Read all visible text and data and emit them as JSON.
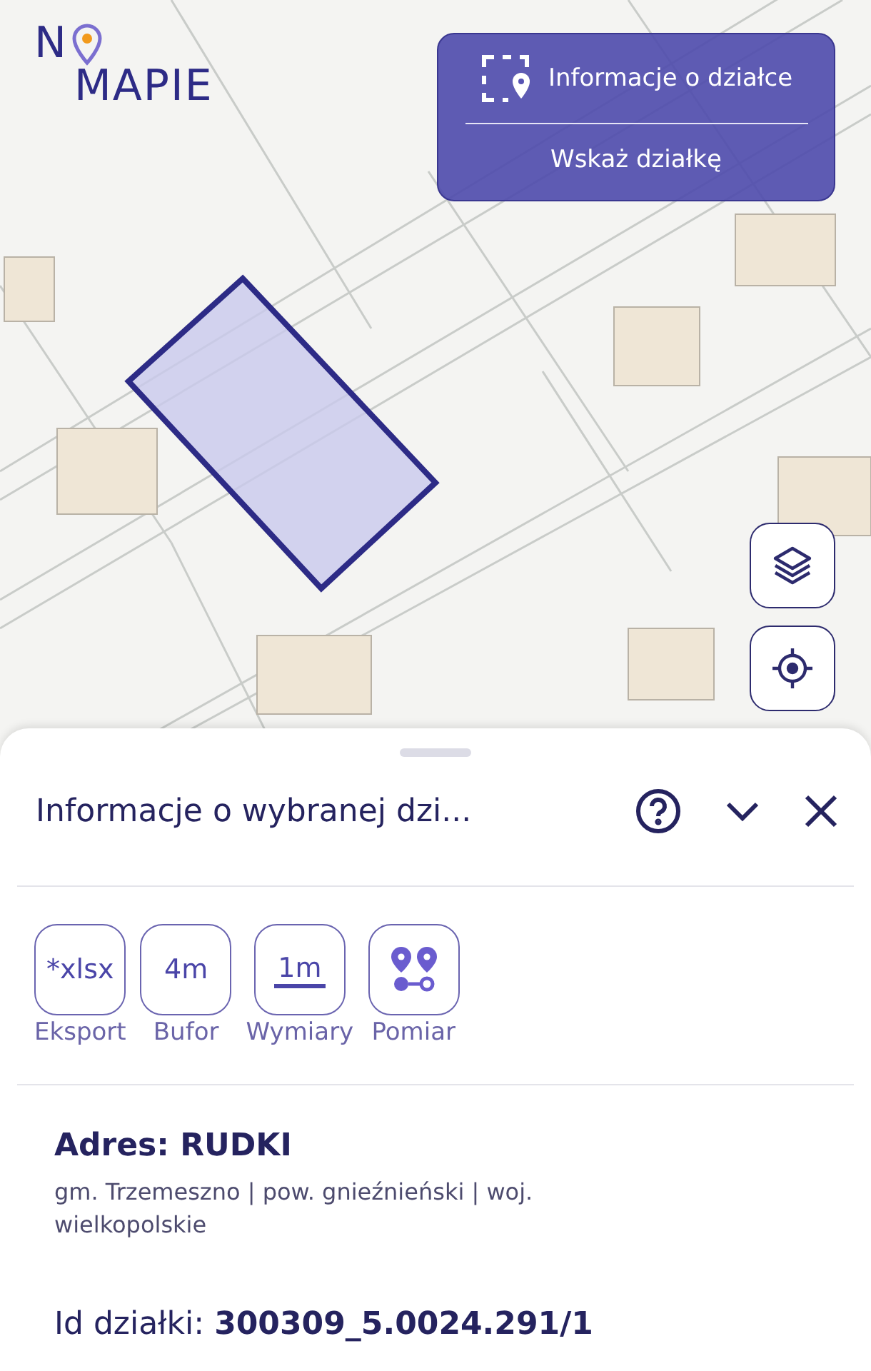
{
  "logo": {
    "first": "N",
    "second": "MAPIE"
  },
  "parcel_menu": {
    "items": [
      {
        "kind": "icon",
        "label": "Informacje o działce"
      },
      {
        "kind": "plain",
        "label": "Wskaż działkę"
      }
    ]
  },
  "map_buttons": [
    {
      "kind": "layers"
    },
    {
      "kind": "locate"
    }
  ],
  "sheet": {
    "title": "Informacje o wybranej dzi...",
    "tools": [
      {
        "kind": "text",
        "glyph": "*xlsx",
        "label": "Eksport"
      },
      {
        "kind": "text",
        "glyph": "4m",
        "label": "Bufor"
      },
      {
        "kind": "dimension",
        "glyph": "1m",
        "label": "Wymiary"
      },
      {
        "kind": "pins",
        "label": "Pomiar"
      }
    ],
    "address": {
      "title": "Adres: RUDKI",
      "details": "gm. Trzemeszno | pow. gnieźnieński | woj. wielkopolskie"
    },
    "parcel_id": "Id działki: **300309_5.0024.291/1**"
  }
}
